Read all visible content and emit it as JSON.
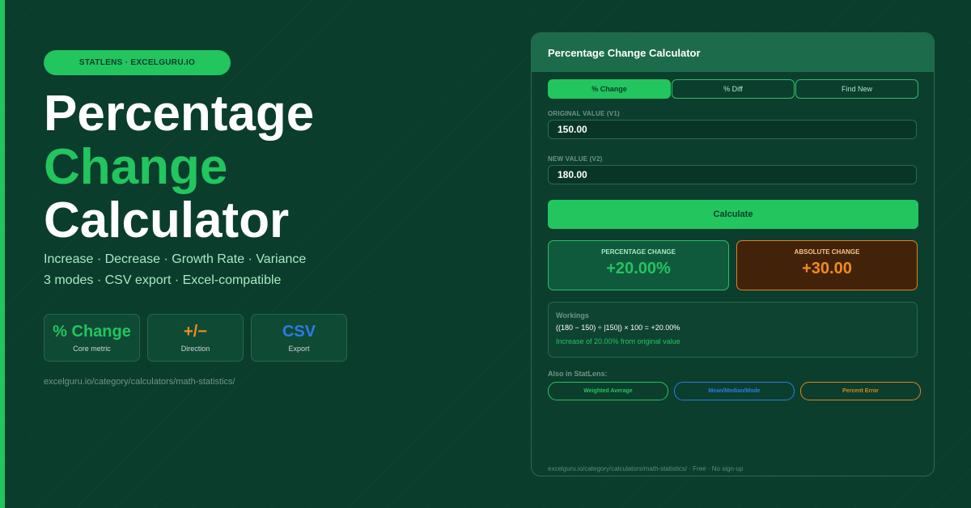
{
  "hero": {
    "badge": "STATLENS · EXCELGURU.IO",
    "title_line1": "Percentage",
    "title_line2": "Change",
    "title_line3": "Calculator",
    "subtitle_line1": "Increase · Decrease · Growth Rate · Variance",
    "subtitle_line2": "3 modes · CSV export · Excel-compatible",
    "stats": [
      {
        "value": "% Change",
        "label": "Core metric"
      },
      {
        "value": "+/−",
        "label": "Direction"
      },
      {
        "value": "CSV",
        "label": "Export"
      }
    ],
    "url": "excelguru.io/category/calculators/math-statistics/"
  },
  "calculator": {
    "title": "Percentage Change Calculator",
    "tabs": [
      "% Change",
      "% Diff",
      "Find New"
    ],
    "active_tab": "% Change",
    "original_label": "ORIGINAL VALUE (V1)",
    "original_value": "150.00",
    "new_label": "NEW VALUE (V2)",
    "new_value": "180.00",
    "calculate_label": "Calculate",
    "result_pct_label": "PERCENTAGE CHANGE",
    "result_pct_value": "+20.00%",
    "result_abs_label": "ABSOLUTE CHANGE",
    "result_abs_value": "+30.00",
    "workings_title": "Workings",
    "workings_formula": "((180 − 150) ÷ |150|) × 100 = +20.00%",
    "workings_note": "Increase of 20.00% from original value",
    "also_label": "Also in StatLens:",
    "related": [
      "Weighted Average",
      "Mean/Median/Mode",
      "Percent Error"
    ],
    "footer": "excelguru.io/category/calculators/math-statistics/ · Free · No sign-up"
  },
  "colors": {
    "background": "#0b3d2c",
    "accent_green": "#22c55e",
    "accent_orange": "#f08c1d",
    "accent_blue": "#2a7ce8"
  }
}
